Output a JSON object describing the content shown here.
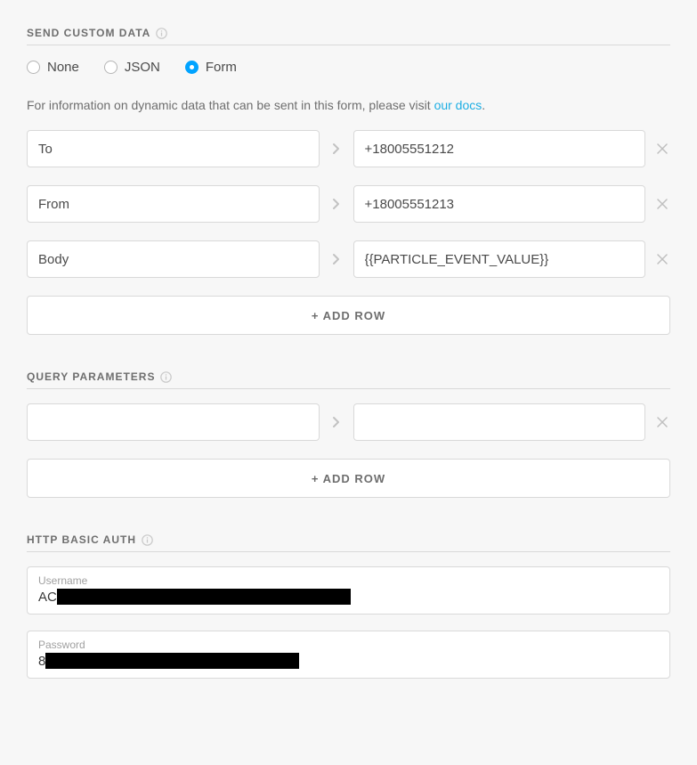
{
  "sendCustomData": {
    "header": "SEND CUSTOM DATA",
    "radios": {
      "none": "None",
      "json": "JSON",
      "form": "Form",
      "selected": "form"
    },
    "hint_prefix": "For information on dynamic data that can be sent in this form, please visit ",
    "hint_link": "our docs",
    "hint_suffix": ".",
    "rows": [
      {
        "key": "To",
        "value": "+18005551212"
      },
      {
        "key": "From",
        "value": "+18005551213"
      },
      {
        "key": "Body",
        "value": "{{PARTICLE_EVENT_VALUE}}"
      }
    ],
    "add_row": "+ ADD ROW"
  },
  "queryParameters": {
    "header": "QUERY PARAMETERS",
    "rows": [
      {
        "key": "",
        "value": ""
      }
    ],
    "add_row": "+ ADD ROW"
  },
  "httpBasicAuth": {
    "header": "HTTP BASIC AUTH",
    "username_label": "Username",
    "username_visible_prefix": "AC",
    "password_label": "Password",
    "password_visible_prefix": "8"
  }
}
